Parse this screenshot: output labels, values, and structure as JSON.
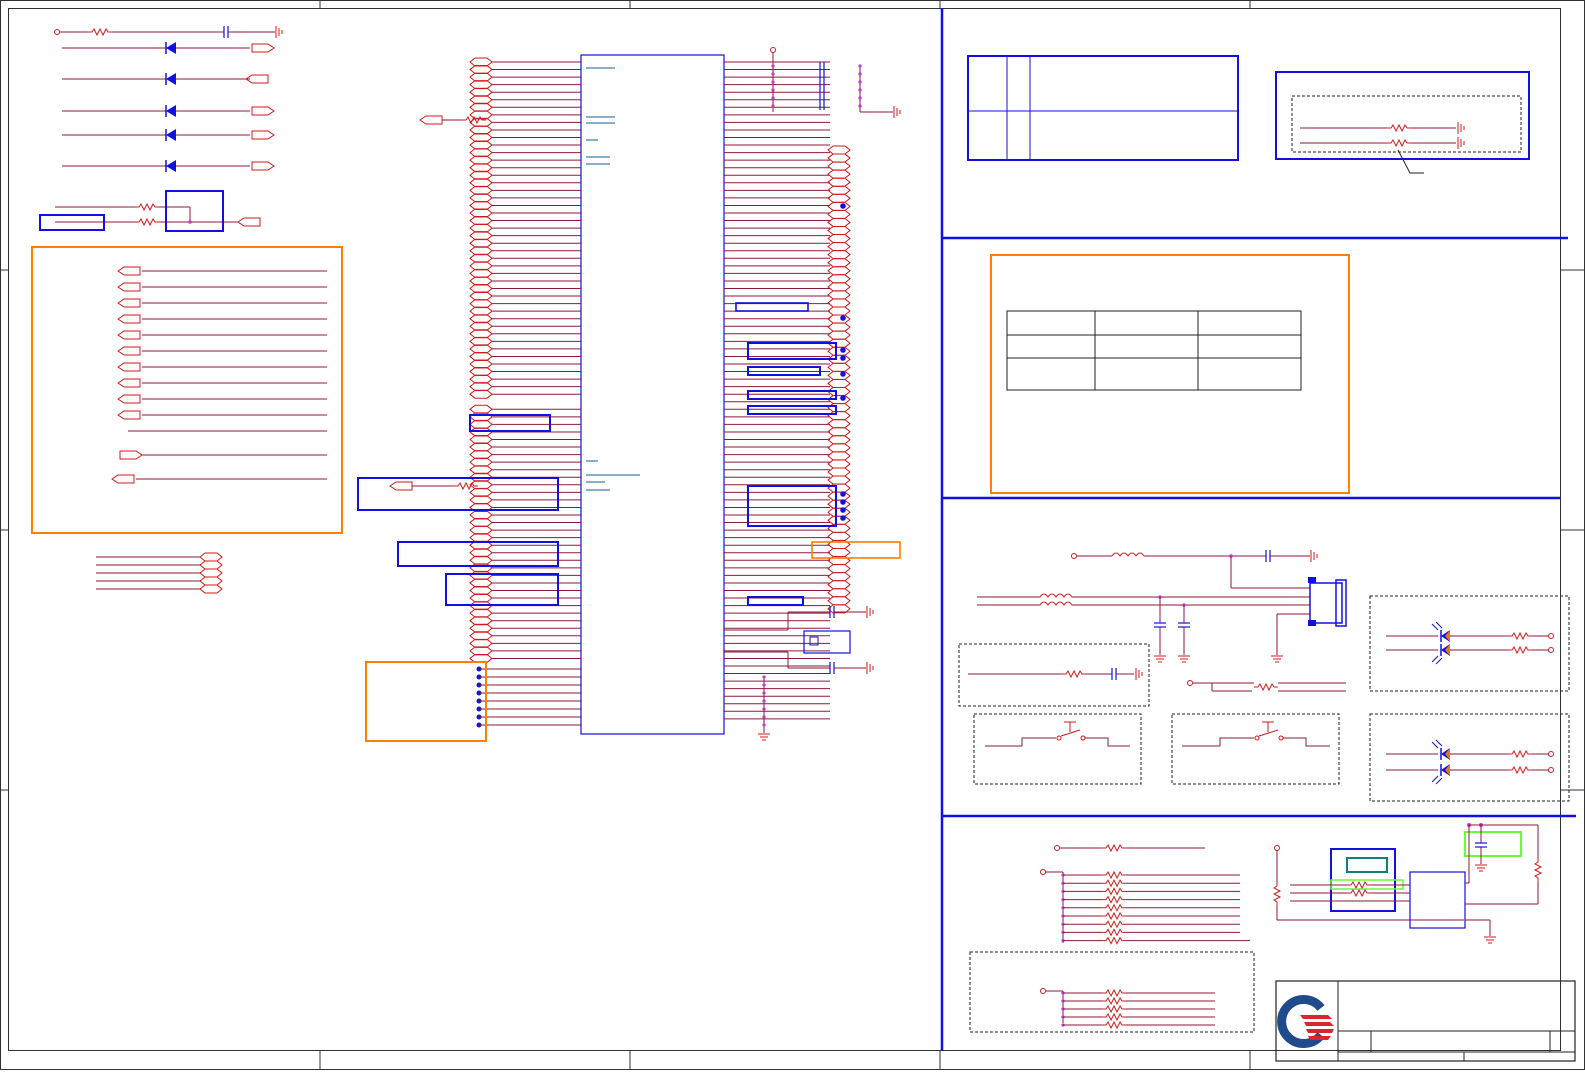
{
  "sheet": {
    "kind": "electronic schematic sheet",
    "text_visible": false
  },
  "colors": {
    "wire": "#8b1a3a",
    "part": "#d11a1a",
    "box": "#1010e0",
    "note_box": "#ff7f00",
    "highlight": "#66ff33",
    "teal": "#0f7f7f",
    "junction": "#cc33cc",
    "border": "#333333"
  },
  "logo": {
    "name": "company-logo",
    "colors": [
      "#1f4a8c",
      "#d8252f"
    ]
  }
}
